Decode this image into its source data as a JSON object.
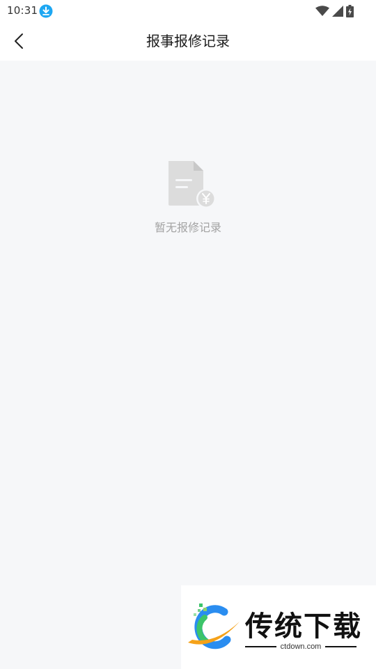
{
  "status_bar": {
    "time": "10:31",
    "download_icon": "download-icon",
    "wifi_icon": "wifi-icon",
    "signal_icon": "signal-icon",
    "battery_icon": "battery-charging-icon"
  },
  "header": {
    "back_icon": "chevron-left-icon",
    "title": "报事报修记录"
  },
  "empty_state": {
    "icon": "document-yen-icon",
    "message": "暂无报修记录"
  },
  "watermark": {
    "brand": "传统下载",
    "domain": "ctdown.com"
  },
  "colors": {
    "background": "#f6f7f9",
    "header_background": "#ffffff",
    "download_badge": "#1ea7f2",
    "empty_icon": "#dcdcdc",
    "empty_text": "#a3a3a3"
  }
}
